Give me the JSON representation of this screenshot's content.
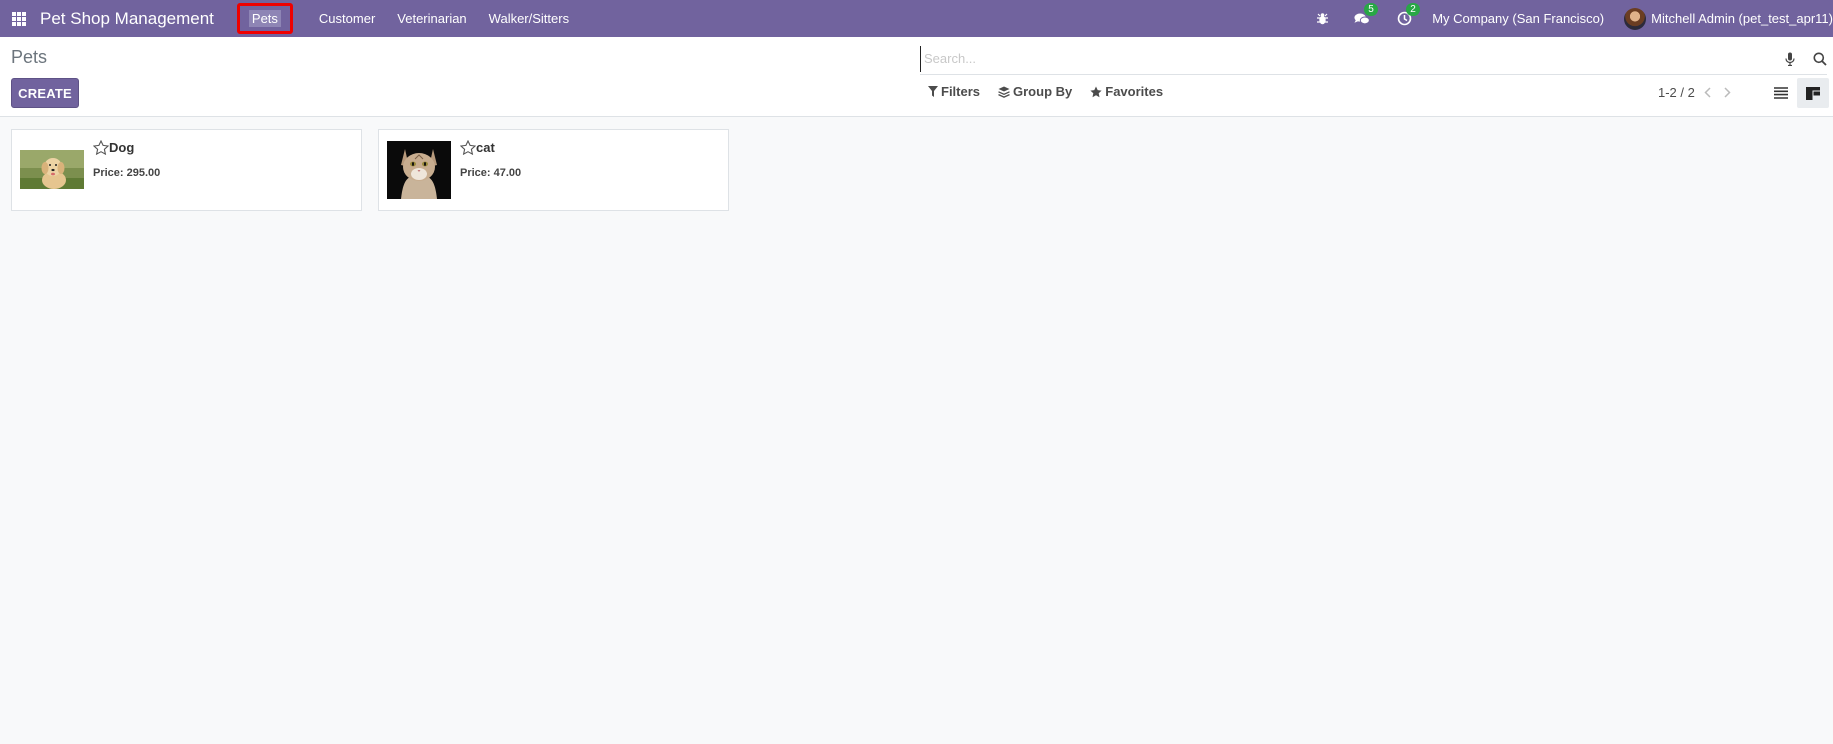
{
  "navbar": {
    "brand": "Pet Shop Management",
    "menu": [
      "Pets",
      "Customer",
      "Veterinarian",
      "Walker/Sitters"
    ],
    "messages_badge": "5",
    "activities_badge": "2",
    "company": "My Company (San Francisco)",
    "user": "Mitchell Admin (pet_test_apr11)"
  },
  "control_panel": {
    "breadcrumb": "Pets",
    "create_label": "CREATE",
    "search_placeholder": "Search...",
    "filters_label": "Filters",
    "group_by_label": "Group By",
    "favorites_label": "Favorites",
    "pager": "1-2 / 2"
  },
  "records": [
    {
      "name": "Dog",
      "price": "Price: 295.00",
      "image": "golden-retriever-photo"
    },
    {
      "name": "cat",
      "price": "Price: 47.00",
      "image": "tabby-cat-photo"
    }
  ],
  "colors": {
    "brand": "#71639e",
    "highlight_box": "#ee0000",
    "badge": "#28a745"
  }
}
